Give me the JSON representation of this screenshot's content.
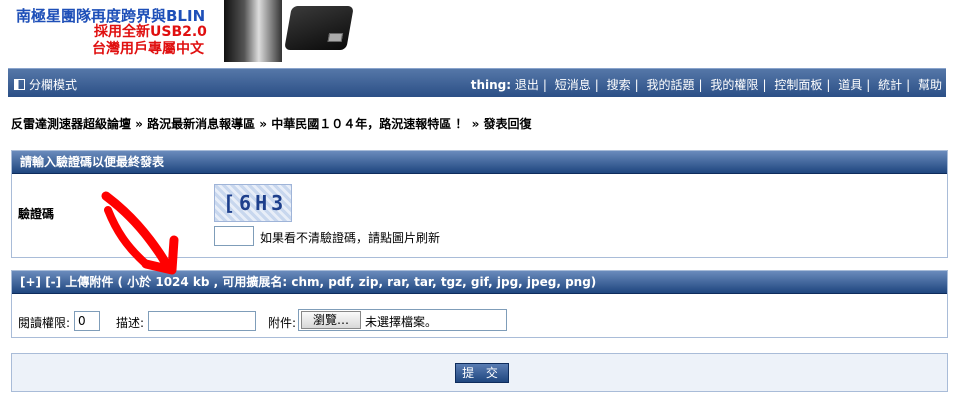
{
  "banner": {
    "line1": "南極星團隊再度跨界與BLIN",
    "line2": "採用全新USB2.0",
    "line3": "台灣用戶專屬中文"
  },
  "nav": {
    "mode_label": "分欄模式",
    "user": "thing:",
    "links": [
      "退出",
      "短消息",
      "搜索",
      "我的話題",
      "我的權限",
      "控制面板",
      "道具",
      "統計",
      "幫助"
    ]
  },
  "breadcrumb": "反雷達測速器超級論壇 » 路況最新消息報導區 » 中華民國１０４年，路況速報特區 ！ » 發表回復",
  "captcha_panel": {
    "header": "請輸入驗證碼以便最終發表",
    "label": "驗證碼",
    "captcha_text": "[6H3",
    "code_value": "",
    "hint": "如果看不清驗證碼，請點圖片刷新"
  },
  "upload_panel": {
    "header": "[+] [-] 上傳附件 ( 小於 1024 kb , 可用擴展名: chm, pdf, zip, rar, tar, tgz, gif, jpg, jpeg, png)",
    "read_perm_label": "閱讀權限:",
    "read_perm_value": "0",
    "desc_label": "描述:",
    "desc_value": "",
    "attach_label": "附件:",
    "browse_label": "瀏覽…",
    "no_file": "未選擇檔案。"
  },
  "submit_label": "提 交",
  "colors": {
    "nav_bg": "#2b4f86",
    "panel_header": "#1f467f",
    "annotation_arrow": "#ff0000"
  }
}
